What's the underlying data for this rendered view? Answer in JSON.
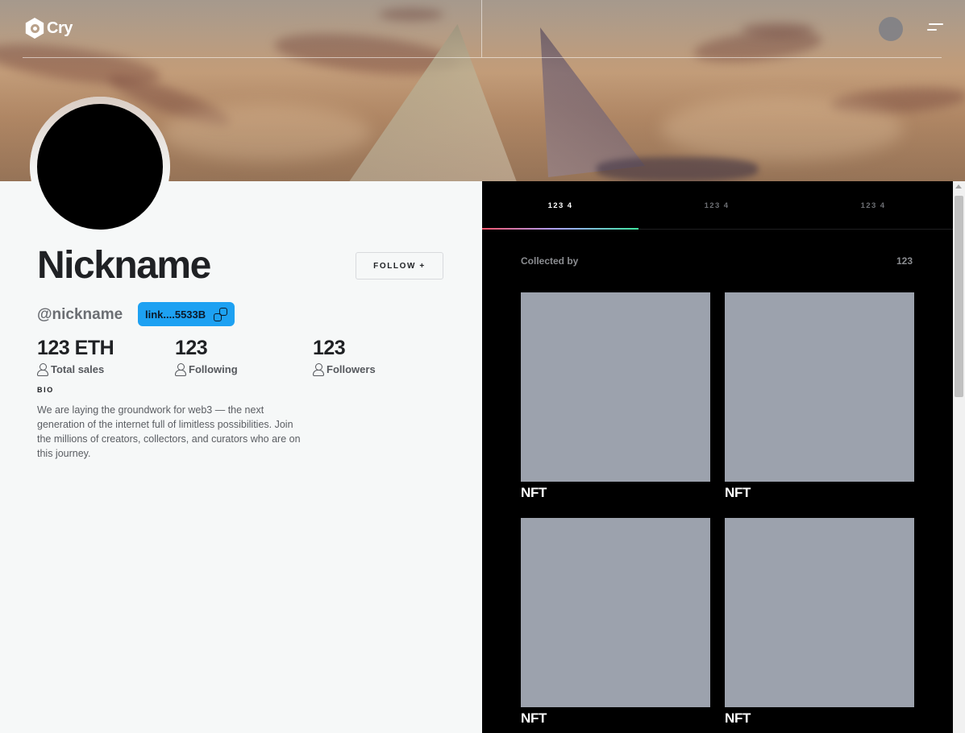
{
  "brand": {
    "name": "Cry"
  },
  "header": {
    "avatar_icon": "user-avatar",
    "menu_icon": "hamburger-menu-icon"
  },
  "profile": {
    "nickname": "Nickname",
    "handle": "@nickname",
    "wallet_link": "link....5533B",
    "follow_label": "FOLLOW +",
    "stats": [
      {
        "value": "123 ETH",
        "label": "Total sales"
      },
      {
        "value": "123",
        "label": "Following"
      },
      {
        "value": "123",
        "label": "Followers"
      }
    ],
    "bio_heading": "BIO",
    "bio": "We are laying the groundwork for web3 — the next generation of the internet full of limitless possibilities. Join the millions of creators, collectors, and curators who are on this journey."
  },
  "collection": {
    "tabs": [
      {
        "label": "123 4",
        "active": true
      },
      {
        "label": "123 4",
        "active": false
      },
      {
        "label": "123 4",
        "active": false
      }
    ],
    "collected_label": "Collected by",
    "collected_count": "123",
    "items": [
      {
        "title": "NFT"
      },
      {
        "title": "NFT"
      },
      {
        "title": "NFT"
      },
      {
        "title": "NFT"
      }
    ]
  },
  "colors": {
    "accent": "#1da1f2",
    "panel_bg": "#000000",
    "page_bg": "#f6f8f8",
    "nft_placeholder": "#9ca2ad"
  }
}
